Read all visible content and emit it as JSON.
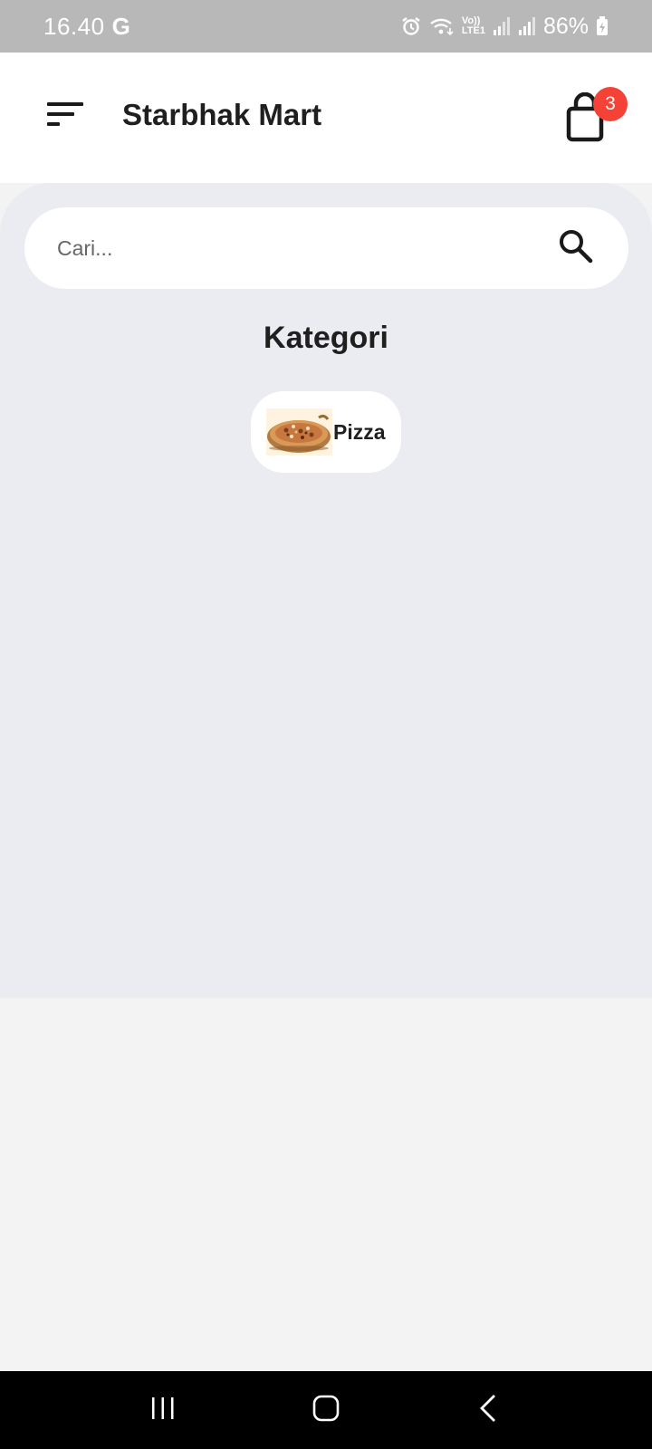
{
  "status_bar": {
    "time": "16.40",
    "google_glyph": "G",
    "battery_percent": "86%",
    "icons": [
      "alarm-icon",
      "wifi-icon",
      "volte-icon",
      "signal-icon",
      "signal-icon",
      "battery-charging-icon"
    ],
    "volte_line1": "Vo))",
    "volte_line2": "LTE1"
  },
  "app_bar": {
    "title": "Starbhak Mart",
    "menu_icon": "sort-menu-icon",
    "cart_icon": "shopping-bag-icon",
    "cart_count": "3"
  },
  "search": {
    "placeholder": "Cari...",
    "icon": "search-icon"
  },
  "categories": {
    "title": "Kategori",
    "items": [
      {
        "label": "Pizza",
        "image": "pizza-image"
      }
    ]
  },
  "nav_bar": {
    "buttons": [
      "recent-apps-icon",
      "home-icon",
      "back-icon"
    ]
  },
  "colors": {
    "status_bar": "#b8b8b8",
    "panel": "#ebebf2",
    "badge": "#f44336",
    "page": "#f3f3f3"
  }
}
